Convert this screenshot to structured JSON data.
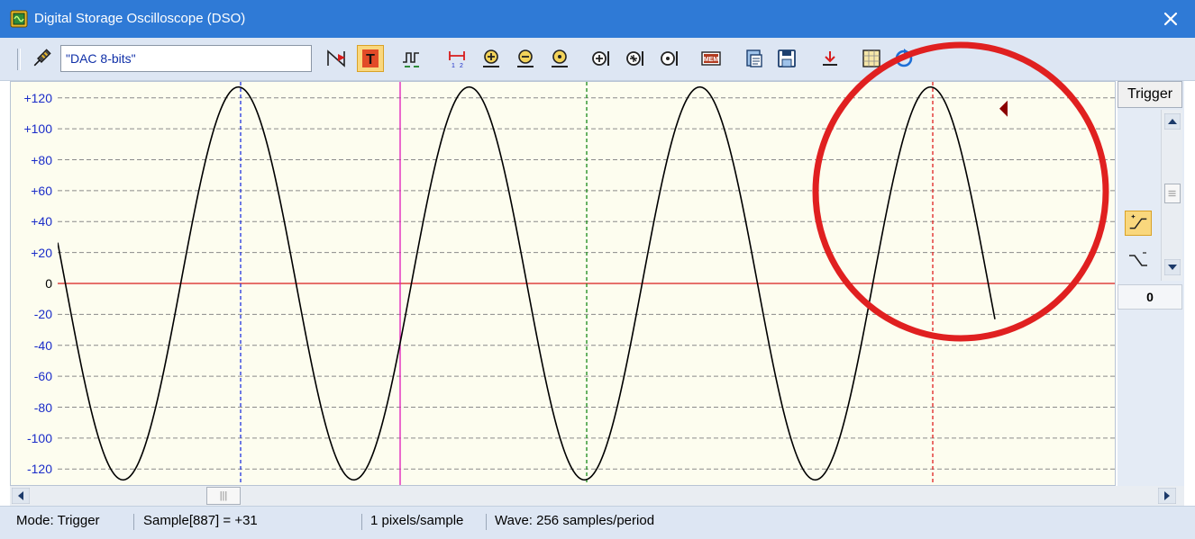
{
  "window": {
    "title": "Digital Storage Oscilloscope (DSO)",
    "close_glyph": "✕",
    "icon": "oscilloscope-chip-icon"
  },
  "toolbar": {
    "channel_value": "\"DAC 8-bits\"",
    "icons": [
      "probe-icon",
      "trigger-mode-icon",
      "trigger-toggle-icon",
      "signal-icon",
      "cursor-measure-icon",
      "zoom-in-icon",
      "zoom-out-icon",
      "zoom-fit-icon",
      "zoom-x-in-icon",
      "zoom-x-out-icon",
      "zoom-x-fit-icon",
      "memory-icon",
      "copy-icon",
      "save-icon",
      "export-icon",
      "grid-icon",
      "refresh-icon"
    ],
    "mem_label": "MEM",
    "trigger_letter": "T"
  },
  "chart_data": {
    "type": "line",
    "series": [
      {
        "name": "",
        "samples_per_period": 256,
        "amplitude": 127,
        "phase_deg": 168,
        "x_start": 0,
        "x_end": 1040
      }
    ],
    "ylim": [
      -128,
      128
    ],
    "y_ticks": [
      "+120",
      "+100",
      "+80",
      "+60",
      "+40",
      "+20",
      "0",
      "-20",
      "-40",
      "-60",
      "-80",
      "-100",
      "-120"
    ],
    "y_tick_values": [
      120,
      100,
      80,
      60,
      40,
      20,
      0,
      -20,
      -40,
      -60,
      -80,
      -100,
      -120
    ],
    "grid": true,
    "colors": {
      "trace": "#000000",
      "zero_line": "#d81c1c",
      "background": "#fdfdef",
      "grid": "#8a8a8a",
      "tick_label": "#1a2cc8",
      "trigger_marker": "#8b0000"
    },
    "cursors": [
      {
        "x": 203,
        "color": "#2233dd",
        "style": "dashed"
      },
      {
        "x": 380,
        "color": "#e01ab8",
        "style": "solid"
      },
      {
        "x": 587,
        "color": "#1a8a1a",
        "style": "dashed"
      },
      {
        "x": 971,
        "color": "#e02020",
        "style": "dashed"
      }
    ],
    "trigger_marker_x": 1045,
    "trigger_marker_y": 113
  },
  "annotation": {
    "circle_color": "#e02020"
  },
  "trigger_panel": {
    "button_label": "Trigger",
    "value": "0",
    "rising_icon": "rising-edge-icon",
    "falling_icon": "falling-edge-icon"
  },
  "hscroll": {
    "thumb_glyph": "|||"
  },
  "status": {
    "mode": "Mode: Trigger",
    "sample": "Sample[887] = +31",
    "zoom": "1 pixels/sample",
    "wave": "Wave: 256 samples/period"
  }
}
